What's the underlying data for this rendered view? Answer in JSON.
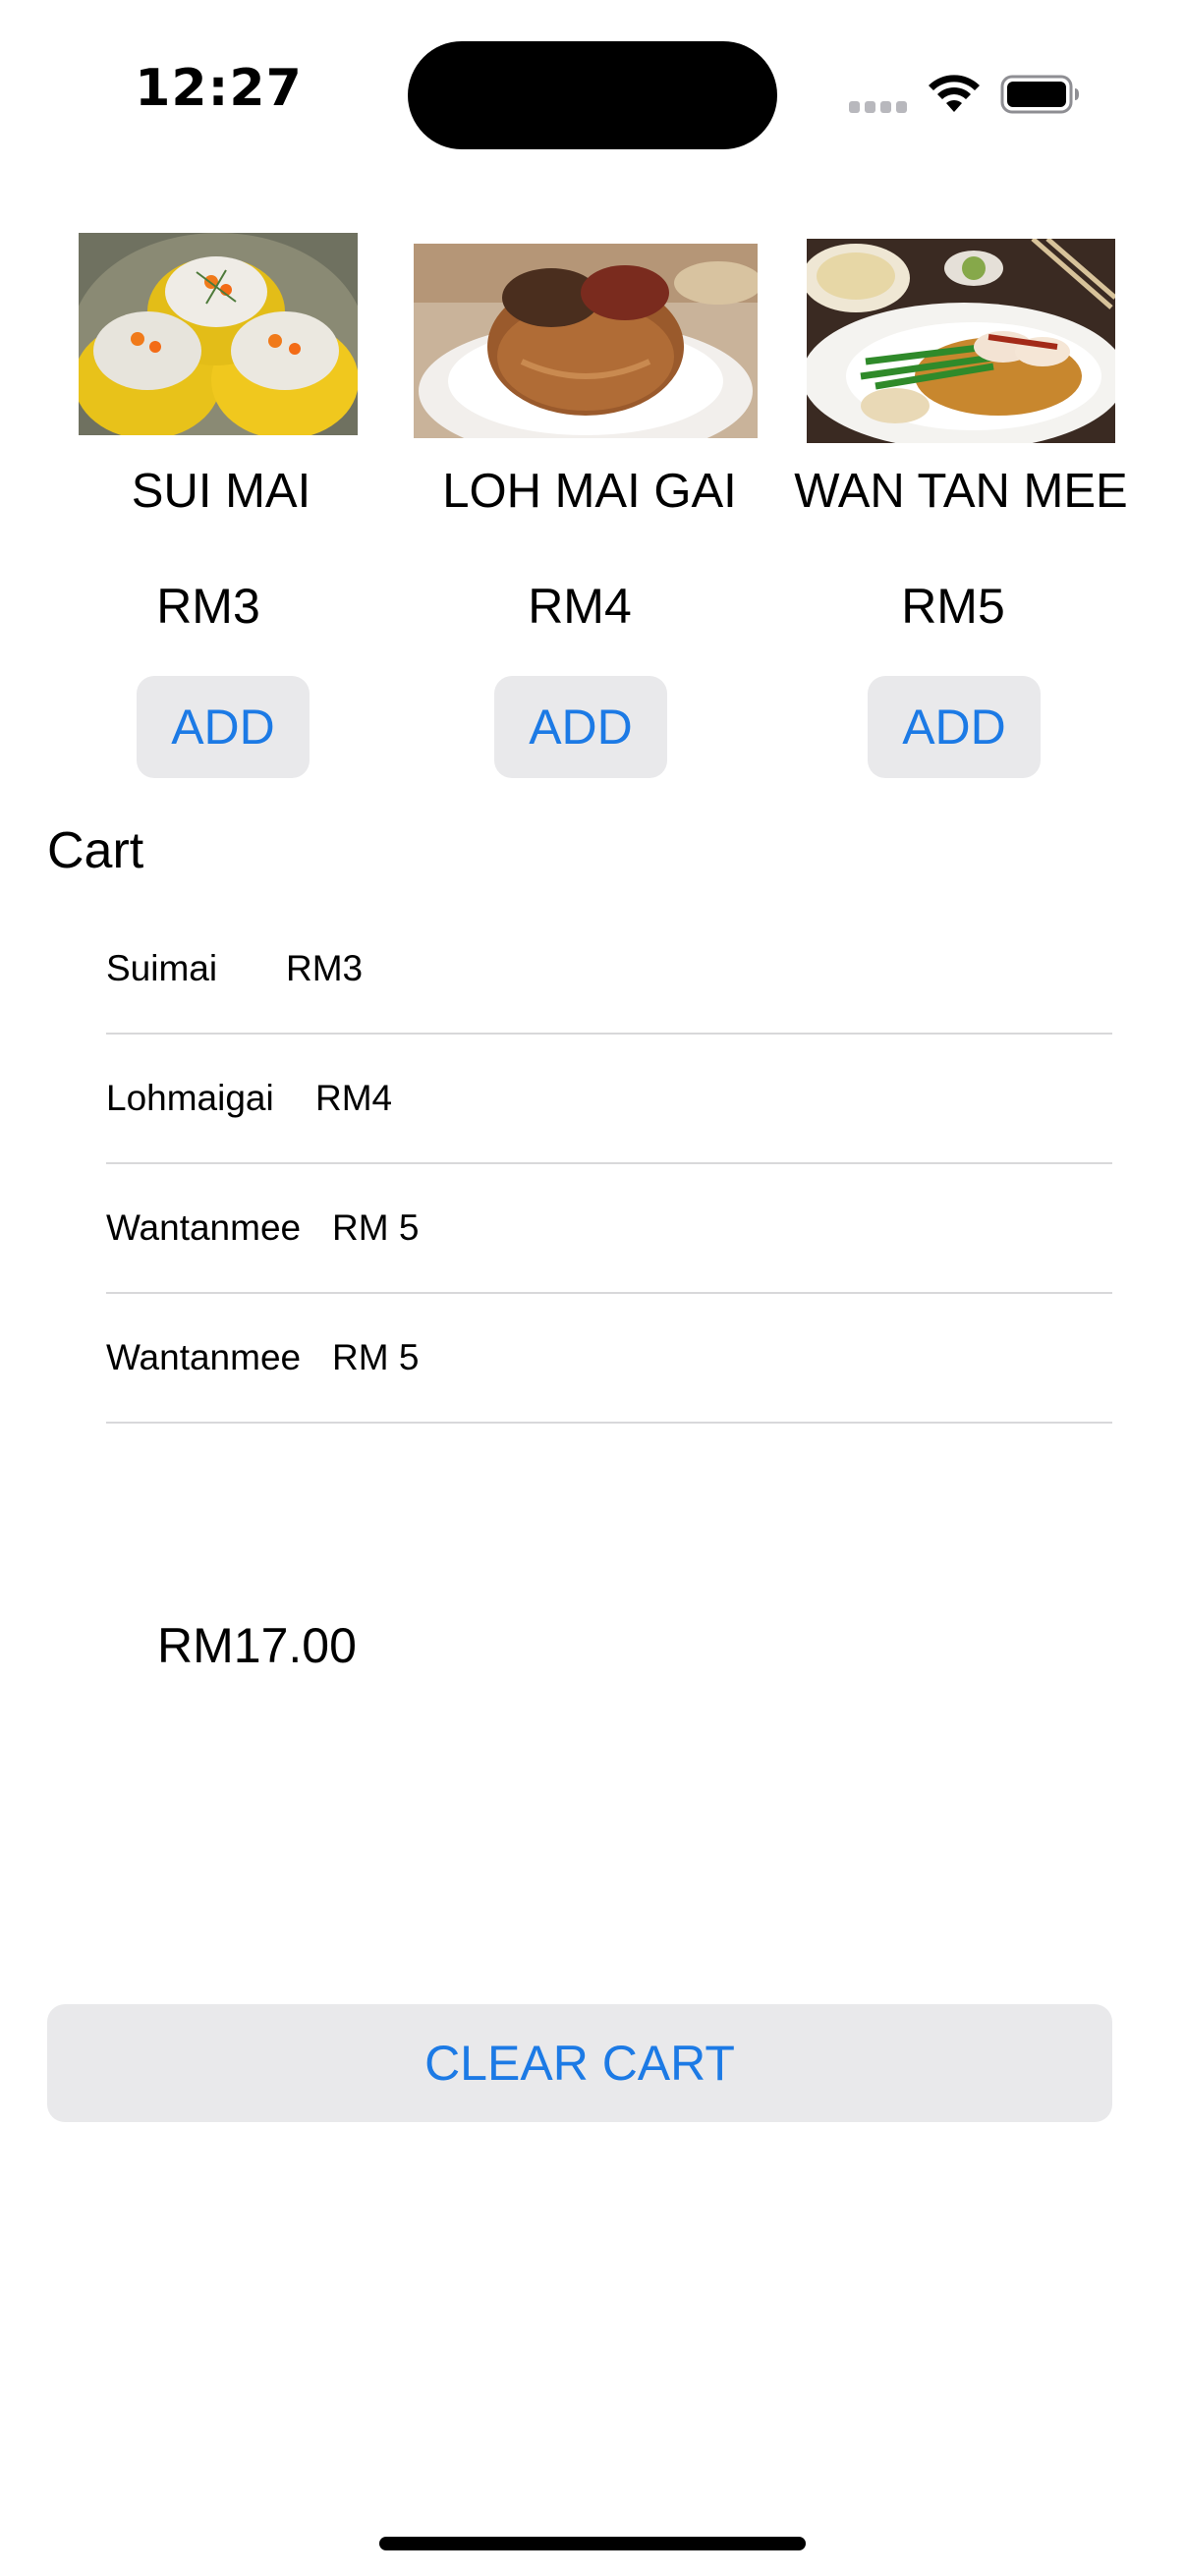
{
  "status_bar": {
    "time": "12:27",
    "icons": [
      "signal-icon",
      "wifi-icon",
      "battery-icon"
    ]
  },
  "products": [
    {
      "name": "SUI MAI",
      "price": "RM3",
      "add_label": "ADD",
      "image": "sui-mai-dumplings-photo"
    },
    {
      "name": "LOH MAI GAI",
      "price": "RM4",
      "add_label": "ADD",
      "image": "loh-mai-gai-photo"
    },
    {
      "name": "WAN TAN MEE",
      "price": "RM5",
      "add_label": "ADD",
      "image": "wan-tan-mee-photo"
    }
  ],
  "cart": {
    "title": "Cart",
    "items": [
      {
        "name": "Suimai",
        "price": "RM3"
      },
      {
        "name": "Lohmaigai",
        "price": "RM4"
      },
      {
        "name": "Wantanmee",
        "price": "RM 5"
      },
      {
        "name": "Wantanmee",
        "price": "RM 5"
      }
    ],
    "total": "RM17.00",
    "clear_label": "CLEAR CART"
  },
  "colors": {
    "accent": "#1c7ae5",
    "button_bg": "#e9e9eb",
    "separator": "#d8d8da"
  }
}
